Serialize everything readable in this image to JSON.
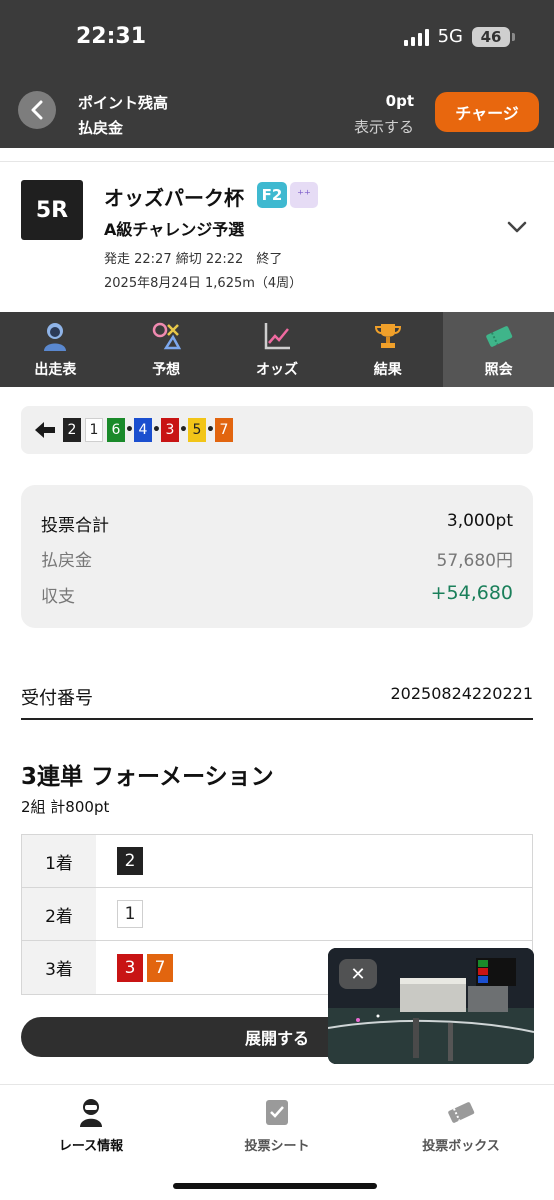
{
  "status_bar": {
    "time": "22:31",
    "network": "5G",
    "battery": "46"
  },
  "header": {
    "point_label": "ポイント残高",
    "refund_label": "払戻金",
    "point_value": "0pt",
    "show_label": "表示する",
    "charge_label": "チャージ"
  },
  "race": {
    "number": "5R",
    "title": "オッズパーク杯",
    "grade": "F2",
    "grade_extra": "⁺⁺",
    "subtitle": "A級チャレンジ予選",
    "info1": "発走 22:27 締切 22:22　終了",
    "info2": "2025年8月24日 1,625m（4周）"
  },
  "tabs": [
    {
      "label": "出走表",
      "icon": "rider-icon"
    },
    {
      "label": "予想",
      "icon": "prediction-icon"
    },
    {
      "label": "オッズ",
      "icon": "odds-chart-icon"
    },
    {
      "label": "結果",
      "icon": "trophy-icon"
    },
    {
      "label": "照会",
      "icon": "ticket-icon"
    }
  ],
  "combo": {
    "numbers": [
      {
        "n": "2",
        "bg": "#222222",
        "fg": "#ffffff"
      },
      {
        "n": "1",
        "bg": "#ffffff",
        "fg": "#222222"
      },
      {
        "n": "6",
        "bg": "#1a8a2a",
        "fg": "#ffffff"
      },
      {
        "n": "4",
        "bg": "#1b4fcf",
        "fg": "#ffffff"
      },
      {
        "n": "3",
        "bg": "#c81414",
        "fg": "#ffffff"
      },
      {
        "n": "5",
        "bg": "#f2c518",
        "fg": "#222222"
      },
      {
        "n": "7",
        "bg": "#e2650f",
        "fg": "#ffffff"
      }
    ]
  },
  "summary": {
    "total_label": "投票合計",
    "total_value": "3,000pt",
    "refund_label": "払戻金",
    "refund_value": "57,680円",
    "balance_label": "収支",
    "balance_value": "+54,680",
    "balance_color": "#1a7f5a"
  },
  "receipt": {
    "label": "受付番号",
    "value": "20250824220221"
  },
  "bet": {
    "title": "3連単 フォーメーション",
    "subtitle": "2組 計800pt",
    "rows": [
      {
        "label": "1着",
        "nums": [
          {
            "n": "2",
            "bg": "#222222",
            "fg": "#ffffff"
          }
        ]
      },
      {
        "label": "2着",
        "nums": [
          {
            "n": "1",
            "bg": "#ffffff",
            "fg": "#222222"
          }
        ]
      },
      {
        "label": "3着",
        "nums": [
          {
            "n": "3",
            "bg": "#c81414",
            "fg": "#ffffff"
          },
          {
            "n": "7",
            "bg": "#e2650f",
            "fg": "#ffffff"
          }
        ]
      }
    ],
    "expand_label": "展開する"
  },
  "video": {
    "close_icon": "close-icon"
  },
  "bottom_nav": [
    {
      "label": "レース情報",
      "icon": "rider-icon",
      "active": true
    },
    {
      "label": "投票シート",
      "icon": "checksheet-icon",
      "active": false
    },
    {
      "label": "投票ボックス",
      "icon": "ticket-icon",
      "active": false
    }
  ],
  "colors": {
    "accent": "#e8670e",
    "dark": "#3b3b3b",
    "balance_positive": "#1a7f5a"
  }
}
